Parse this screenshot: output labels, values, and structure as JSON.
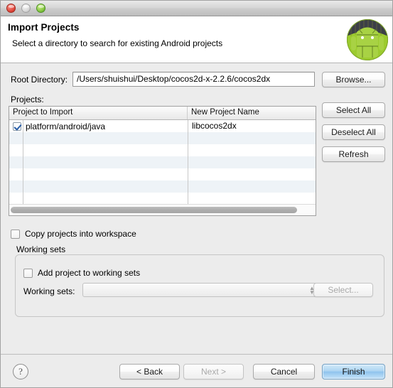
{
  "window": {
    "traffic_lights": [
      "close",
      "minimize",
      "zoom"
    ]
  },
  "header": {
    "title": "Import Projects",
    "subtitle": "Select a directory to search for existing Android projects",
    "logo": "android-robot-icon"
  },
  "form": {
    "root_directory_label": "Root Directory:",
    "root_directory_value": "/Users/shuishui/Desktop/cocos2d-x-2.2.6/cocos2dx",
    "root_directory_placeholder": "",
    "browse_label": "Browse...",
    "projects_label": "Projects:"
  },
  "side_buttons": {
    "select_all": "Select All",
    "deselect_all": "Deselect All",
    "refresh": "Refresh"
  },
  "table": {
    "columns": [
      "Project to Import",
      "New Project Name"
    ],
    "rows": [
      {
        "checked": true,
        "project": "platform/android/java",
        "new_name": "libcocos2dx"
      }
    ],
    "empty_row_count": 8
  },
  "options": {
    "copy_projects_label": "Copy projects into workspace",
    "copy_projects_checked": false
  },
  "working_sets": {
    "group_title": "Working sets",
    "add_label": "Add project to working sets",
    "add_checked": false,
    "combo_label": "Working sets:",
    "combo_value": "",
    "select_label": "Select...",
    "select_disabled": true
  },
  "footer": {
    "help": "?",
    "back": "< Back",
    "next": "Next >",
    "next_disabled": true,
    "cancel": "Cancel",
    "finish": "Finish"
  },
  "colors": {
    "default_button": "#8fc4ee",
    "checkbox_check": "#2b5fa8",
    "android_green": "#9ccb2f"
  }
}
